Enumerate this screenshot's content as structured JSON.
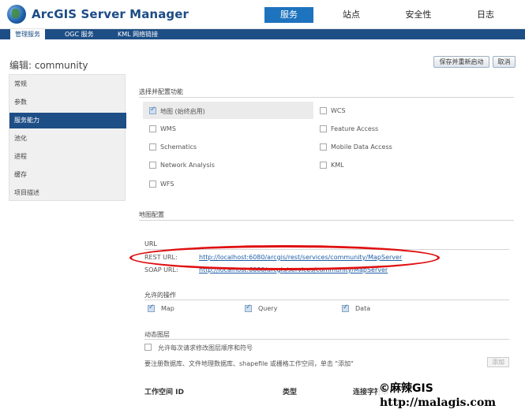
{
  "header": {
    "app_title": "ArcGIS Server Manager",
    "nav": [
      "服务",
      "站点",
      "安全性",
      "日志"
    ]
  },
  "subnav": [
    "管理服务",
    "OGC 服务",
    "KML 网络链接"
  ],
  "page_title": "编辑: community",
  "buttons": {
    "save_restart": "保存并重新启动",
    "cancel": "取消"
  },
  "sidebar": [
    "常规",
    "参数",
    "服务能力",
    "池化",
    "进程",
    "缓存",
    "项目描述"
  ],
  "capabilities": {
    "title": "选择并配置功能",
    "left": [
      {
        "label": "地图 (始终启用)",
        "checked": true
      },
      {
        "label": "WMS",
        "checked": false
      },
      {
        "label": "Schematics",
        "checked": false
      },
      {
        "label": "Network Analysis",
        "checked": false
      },
      {
        "label": "WFS",
        "checked": false
      }
    ],
    "right": [
      {
        "label": "WCS",
        "checked": false
      },
      {
        "label": "Feature Access",
        "checked": false
      },
      {
        "label": "Mobile Data Access",
        "checked": false
      },
      {
        "label": "KML",
        "checked": false
      }
    ]
  },
  "map_config": {
    "title": "地图配置",
    "url_header": "URL",
    "rest_label": "REST URL:",
    "rest_url": "http://localhost:6080/arcgis/rest/services/community/MapServer",
    "soap_label": "SOAP URL:",
    "soap_url": "http://localhost:6080/arcgis/services/community/MapServer",
    "ops_header": "允许的操作",
    "ops": [
      {
        "label": "Map",
        "checked": true
      },
      {
        "label": "Query",
        "checked": true
      },
      {
        "label": "Data",
        "checked": true
      }
    ],
    "dyn_header": "动态图层",
    "dyn_checkbox": "允许每次请求修改图层顺序和符号",
    "register_text": "要注册数据库、文件地理数据库、shapefile 或栅格工作空间，单击 \"添加\"",
    "add_button": "添加",
    "columns": [
      "工作空间 ID",
      "类型",
      "连接字符串"
    ]
  },
  "watermark": {
    "line1": "©麻辣GIS",
    "line2": "http://malagis.com"
  }
}
